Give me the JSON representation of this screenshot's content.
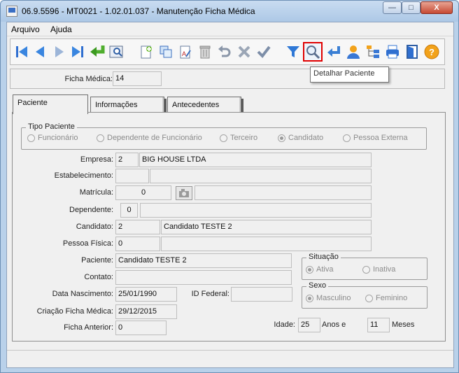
{
  "window": {
    "title": "06.9.5596 - MT0021 - 1.02.01.037 - Manutenção Ficha Médica",
    "minimize": "—",
    "maximize": "□",
    "close": "X"
  },
  "menu": {
    "items": [
      "Arquivo",
      "Ajuda"
    ]
  },
  "toolbar": {
    "buttons": [
      "first-icon",
      "previous-icon",
      "next-icon",
      "last-icon",
      "goto-icon",
      "search-record-icon",
      "new-icon",
      "copy-icon",
      "edit-icon",
      "delete-icon",
      "undo-icon",
      "cancel-icon",
      "confirm-icon",
      "filter-icon",
      "zoom-icon",
      "return-icon",
      "user-icon",
      "tree-icon",
      "print-icon",
      "exit-icon",
      "help-icon"
    ],
    "tooltip": "Detalhar Paciente"
  },
  "ficha": {
    "label": "Ficha Médica:",
    "value": "14"
  },
  "tabs": [
    "Paciente",
    "Informações",
    "Antecedentes"
  ],
  "tipo_paciente": {
    "title": "Tipo Paciente",
    "options": [
      "Funcionário",
      "Dependente de Funcionário",
      "Terceiro",
      "Candidato",
      "Pessoa Externa"
    ],
    "selected": "Candidato"
  },
  "form": {
    "empresa": {
      "label": "Empresa:",
      "code": "2",
      "name": "BIG HOUSE LTDA"
    },
    "estabelecimento": {
      "label": "Estabelecimento:",
      "code": "",
      "name": ""
    },
    "matricula": {
      "label": "Matrícula:",
      "code": "0",
      "name": ""
    },
    "dependente": {
      "label": "Dependente:",
      "code": "0",
      "name": ""
    },
    "candidato": {
      "label": "Candidato:",
      "code": "2",
      "name": "Candidato TESTE 2"
    },
    "pessoa_fisica": {
      "label": "Pessoa Física:",
      "code": "0",
      "name": ""
    },
    "paciente": {
      "label": "Paciente:",
      "value": "Candidato TESTE 2"
    },
    "contato": {
      "label": "Contato:",
      "value": ""
    },
    "data_nascimento": {
      "label": "Data Nascimento:",
      "value": "25/01/1990"
    },
    "id_federal": {
      "label": "ID Federal:",
      "value": ""
    },
    "criacao": {
      "label": "Criação Ficha Médica:",
      "value": "29/12/2015"
    },
    "ficha_anterior": {
      "label": "Ficha Anterior:",
      "value": "0"
    },
    "idade": {
      "label": "Idade:",
      "anos": "25",
      "anos_label": "Anos e",
      "meses": "11",
      "meses_label": "Meses"
    }
  },
  "situacao": {
    "title": "Situação",
    "options": [
      "Ativa",
      "Inativa"
    ],
    "selected": "Ativa"
  },
  "sexo": {
    "title": "Sexo",
    "options": [
      "Masculino",
      "Feminino"
    ],
    "selected": "Masculino"
  },
  "colors": {
    "accent": "#3a78d4",
    "highlight_border": "#e00000",
    "window_frame": "#b9d1ea"
  }
}
